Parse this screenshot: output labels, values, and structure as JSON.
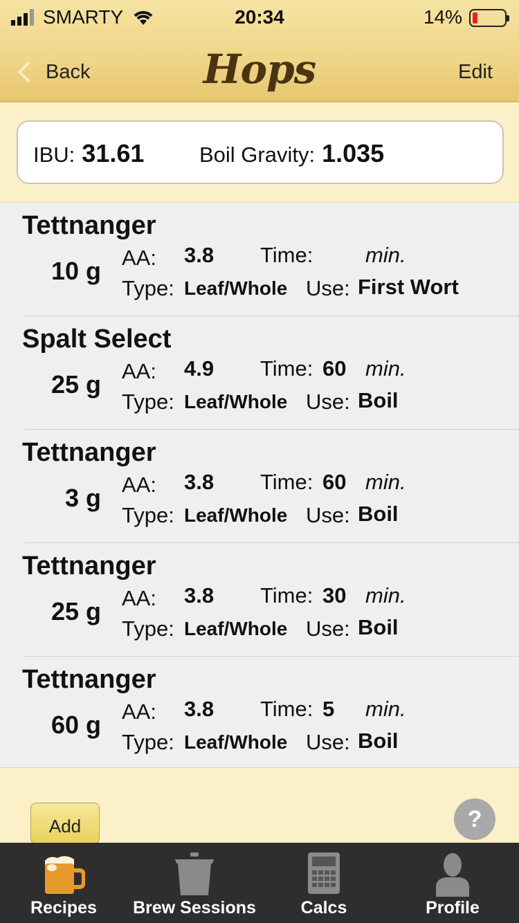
{
  "status_bar": {
    "carrier": "SMARTY",
    "time": "20:34",
    "battery": "14%"
  },
  "nav": {
    "back_label": "Back",
    "title": "Hops",
    "edit_label": "Edit"
  },
  "summary": {
    "ibu_label": "IBU:",
    "ibu_value": "31.61",
    "gravity_label": "Boil Gravity:",
    "gravity_value": "1.035"
  },
  "labels": {
    "aa": "AA:",
    "time": "Time:",
    "min": "min.",
    "type": "Type:",
    "use": "Use:"
  },
  "hops": [
    {
      "name": "Tettnanger",
      "amount": "10 g",
      "aa": "3.8",
      "time": "",
      "type": "Leaf/Whole",
      "use": "First Wort"
    },
    {
      "name": "Spalt Select",
      "amount": "25 g",
      "aa": "4.9",
      "time": "60",
      "type": "Leaf/Whole",
      "use": "Boil"
    },
    {
      "name": "Tettnanger",
      "amount": "3 g",
      "aa": "3.8",
      "time": "60",
      "type": "Leaf/Whole",
      "use": "Boil"
    },
    {
      "name": "Tettnanger",
      "amount": "25 g",
      "aa": "3.8",
      "time": "30",
      "type": "Leaf/Whole",
      "use": "Boil"
    },
    {
      "name": "Tettnanger",
      "amount": "60 g",
      "aa": "3.8",
      "time": "5",
      "type": "Leaf/Whole",
      "use": "Boil"
    }
  ],
  "actions": {
    "add_label": "Add",
    "help_label": "?"
  },
  "tabbar": {
    "tabs": [
      {
        "label": "Recipes",
        "icon": "beer-mug-icon"
      },
      {
        "label": "Brew Sessions",
        "icon": "brew-pot-icon"
      },
      {
        "label": "Calcs",
        "icon": "calculator-icon"
      },
      {
        "label": "Profile",
        "icon": "profile-icon"
      }
    ]
  },
  "colors": {
    "header": "#efd588",
    "background": "#fcf0c8",
    "list_background": "#efefef",
    "tabbar": "#2e2e2e",
    "battery_low": "#ee2222"
  }
}
